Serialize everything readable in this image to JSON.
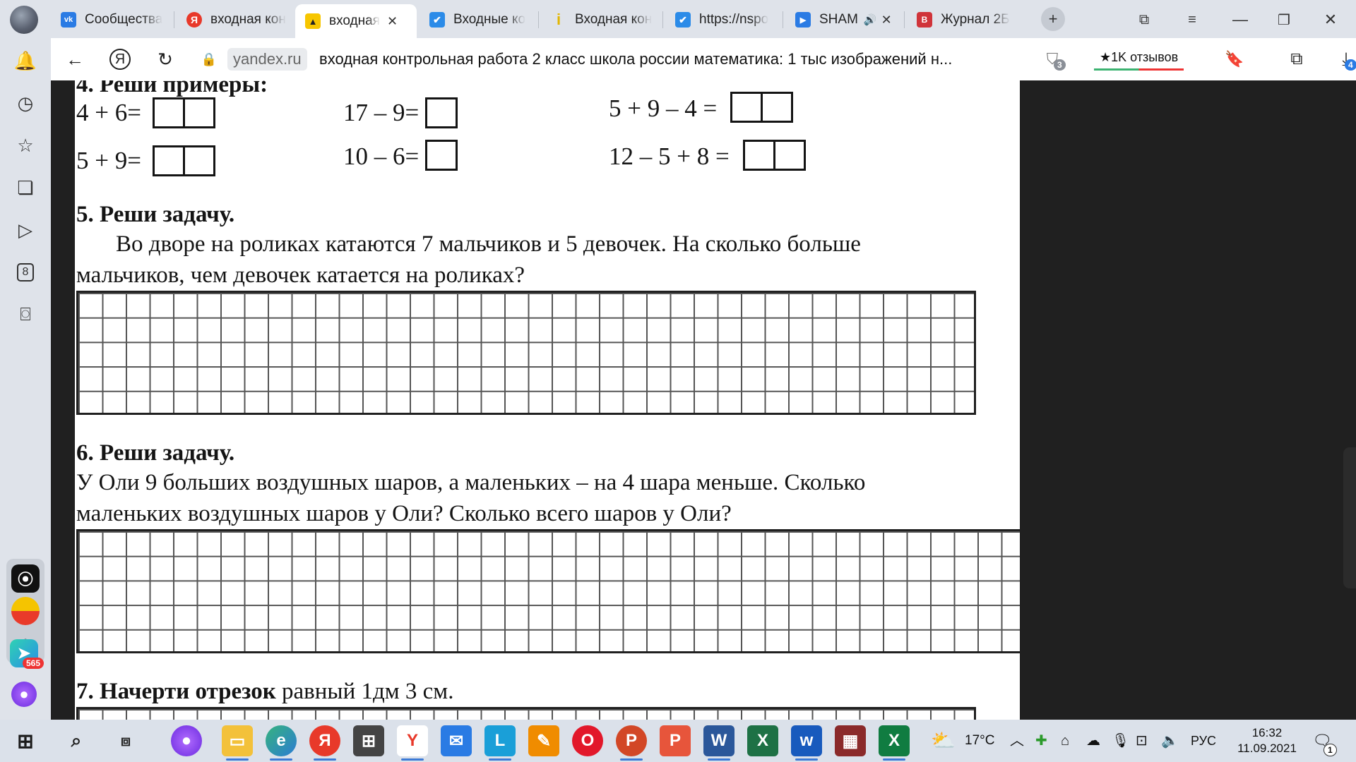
{
  "browser": {
    "tabs": [
      {
        "title": "Сообщества",
        "favicon": "vk-icon",
        "color": "#2a7be4",
        "glyph": "vk"
      },
      {
        "title": "входная кон",
        "favicon": "yandex-icon",
        "color": "#e8392a",
        "glyph": "Я"
      },
      {
        "title": "входная",
        "favicon": "image-search-icon",
        "color": "#f7c600",
        "glyph": "▲",
        "active": true
      },
      {
        "title": "Входные ко",
        "favicon": "check-icon",
        "color": "#2b8be8",
        "glyph": "✔"
      },
      {
        "title": "Входная кон",
        "favicon": "info-icon",
        "color": "#f2c200",
        "glyph": "i"
      },
      {
        "title": "https://nspo",
        "favicon": "check-icon",
        "color": "#2b8be8",
        "glyph": "✔"
      },
      {
        "title": "SHAM",
        "favicon": "play-icon",
        "color": "#2a7be4",
        "glyph": "▶",
        "audio": true
      },
      {
        "title": "Журнал 2Б",
        "favicon": "journal-icon",
        "color": "#d0343a",
        "glyph": "B"
      }
    ],
    "new_tab_icon": "+",
    "address": {
      "host": "yandex.ru",
      "query": "входная контрольная работа 2 класс школа россии математика: 1 тыс изображений н..."
    },
    "reviews_label": "★1K отзывов",
    "protect_badge": "3",
    "downloads_badge": "4"
  },
  "sidebar": {
    "messenger_badge": "565",
    "tab_count_label": "8"
  },
  "page": {
    "task4": {
      "heading": "4.   Реши примеры:",
      "examples": [
        "4 + 6=",
        "17 – 9=",
        "5 + 9 – 4 =",
        "5 + 9=",
        "10 – 6=",
        "12 – 5 + 8 ="
      ]
    },
    "task5": {
      "heading": "5.   Реши задачу.",
      "line1": "Во  дворе  на  роликах  катаются 7 мальчиков  и 5 девочек. На сколько больше",
      "line2": "мальчиков, чем девочек катается на  роликах?"
    },
    "task6": {
      "heading": "6.   Реши задачу.",
      "line1": "У Оли 9 больших воздушных шаров,  а маленьких – на 4 шара меньше. Сколько",
      "line2": "маленьких воздушных шаров у Оли? Сколько всего шаров у Оли?"
    },
    "task7": {
      "heading": "7. Начерти отрезок",
      "rest": " равный 1дм 3 см."
    }
  },
  "taskbar": {
    "weather": "17°C",
    "language": "РУС",
    "time": "16:32",
    "date": "11.09.2021",
    "notifications": "1"
  }
}
